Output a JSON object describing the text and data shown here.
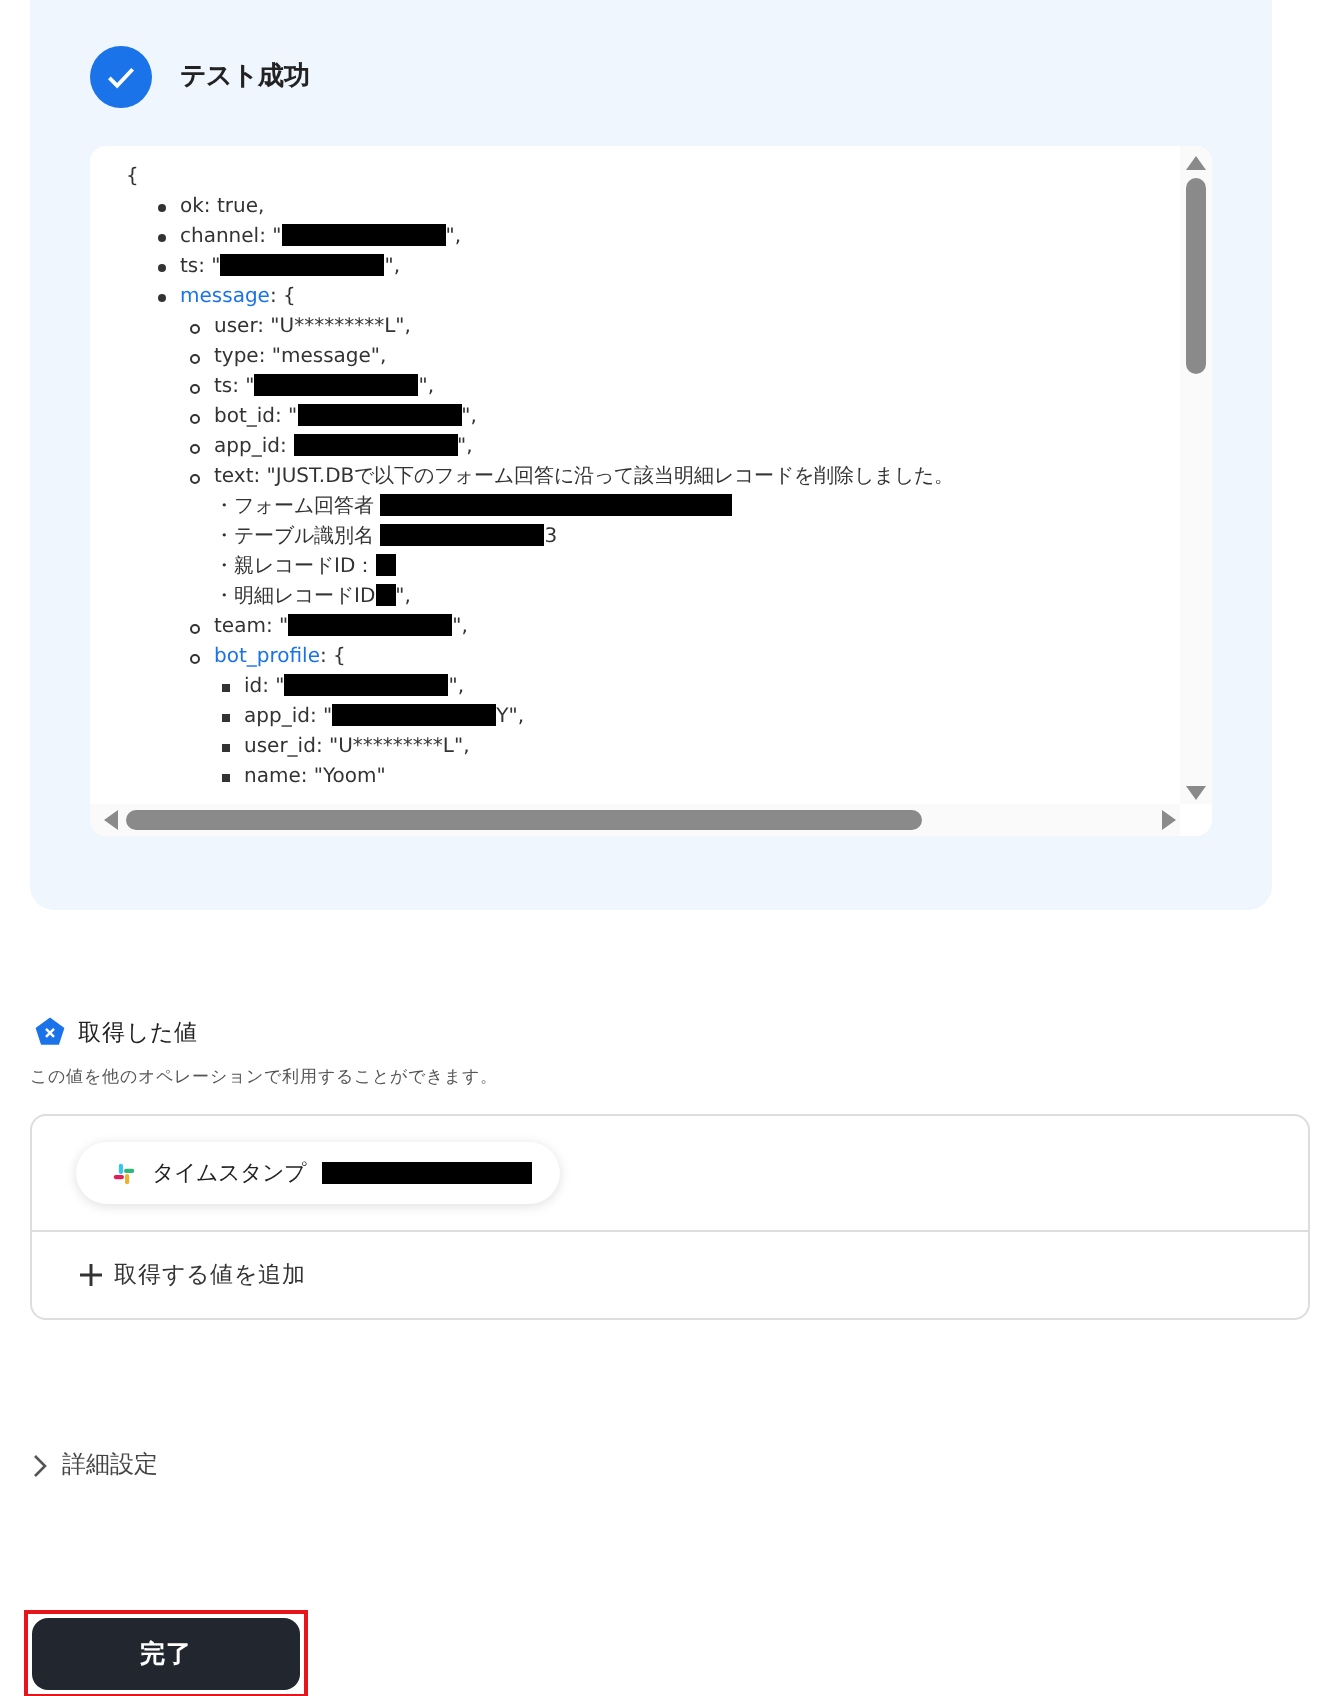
{
  "result": {
    "title": "テスト成功",
    "lines": [
      {
        "kind": "plain",
        "parts": [
          {
            "kind": "text",
            "text": "{"
          }
        ]
      },
      {
        "kind": "disc",
        "parts": [
          {
            "kind": "text",
            "text": "ok: true,"
          }
        ]
      },
      {
        "kind": "disc",
        "parts": [
          {
            "kind": "text",
            "text": "channel: \""
          },
          {
            "kind": "redaction"
          },
          {
            "kind": "text",
            "text": "\","
          }
        ]
      },
      {
        "kind": "disc",
        "parts": [
          {
            "kind": "text",
            "text": "ts: \""
          },
          {
            "kind": "redaction"
          },
          {
            "kind": "text",
            "text": "\","
          }
        ]
      },
      {
        "kind": "disc",
        "parts": [
          {
            "kind": "key",
            "text": "message"
          },
          {
            "kind": "text",
            "text": ": {"
          }
        ],
        "children": [
          {
            "kind": "circle",
            "parts": [
              {
                "kind": "text",
                "text": "user: \"U*********L\","
              }
            ]
          },
          {
            "kind": "circle",
            "parts": [
              {
                "kind": "text",
                "text": "type: \"message\","
              }
            ]
          },
          {
            "kind": "circle",
            "parts": [
              {
                "kind": "text",
                "text": "ts: \""
              },
              {
                "kind": "redaction"
              },
              {
                "kind": "text",
                "text": "\","
              }
            ]
          },
          {
            "kind": "circle",
            "parts": [
              {
                "kind": "text",
                "text": "bot_id: \""
              },
              {
                "kind": "redaction"
              },
              {
                "kind": "text",
                "text": "\","
              }
            ]
          },
          {
            "kind": "circle",
            "parts": [
              {
                "kind": "text",
                "text": "app_id: "
              },
              {
                "kind": "redaction"
              },
              {
                "kind": "text",
                "text": "\","
              }
            ]
          },
          {
            "kind": "circle",
            "parts": [
              {
                "kind": "text",
                "text": "text: \"JUST.DBで以下のフォーム回答に沿って該当明細レコードを削除しました。"
              },
              {
                "kind": "break"
              },
              {
                "kind": "text",
                "text": "・フォーム回答者 "
              },
              {
                "kind": "redaction-wide"
              },
              {
                "kind": "break"
              },
              {
                "kind": "text",
                "text": "・テーブル識別名 "
              },
              {
                "kind": "redaction"
              },
              {
                "kind": "text",
                "text": "3"
              },
              {
                "kind": "break"
              },
              {
                "kind": "text",
                "text": "・親レコードID："
              },
              {
                "kind": "redaction-small"
              },
              {
                "kind": "break"
              },
              {
                "kind": "text",
                "text": "・明細レコードID"
              },
              {
                "kind": "redaction-small"
              },
              {
                "kind": "text",
                "text": "\","
              }
            ]
          },
          {
            "kind": "circle",
            "parts": [
              {
                "kind": "text",
                "text": "team: \""
              },
              {
                "kind": "redaction"
              },
              {
                "kind": "text",
                "text": "\","
              }
            ]
          },
          {
            "kind": "circle",
            "parts": [
              {
                "kind": "key",
                "text": "bot_profile"
              },
              {
                "kind": "text",
                "text": ": {"
              }
            ],
            "children": [
              {
                "kind": "square",
                "parts": [
                  {
                    "kind": "text",
                    "text": "id: \""
                  },
                  {
                    "kind": "redaction"
                  },
                  {
                    "kind": "text",
                    "text": "\","
                  }
                ]
              },
              {
                "kind": "square",
                "parts": [
                  {
                    "kind": "text",
                    "text": "app_id: \""
                  },
                  {
                    "kind": "redaction"
                  },
                  {
                    "kind": "text",
                    "text": "Y\","
                  }
                ]
              },
              {
                "kind": "square",
                "parts": [
                  {
                    "kind": "text",
                    "text": "user_id: \"U*********L\","
                  }
                ]
              },
              {
                "kind": "square",
                "parts": [
                  {
                    "kind": "text",
                    "text": "name: \"Yoom\""
                  }
                ]
              }
            ]
          }
        ]
      }
    ]
  },
  "values": {
    "title": "取得した値",
    "description": "この値を他のオペレーションで利用することができます。",
    "items": [
      {
        "label": "タイムスタンプ"
      }
    ],
    "add_label": "取得する値を追加"
  },
  "advanced": {
    "label": "詳細設定",
    "expanded": false
  },
  "done_button": {
    "label": "完了",
    "highlighted": true
  }
}
